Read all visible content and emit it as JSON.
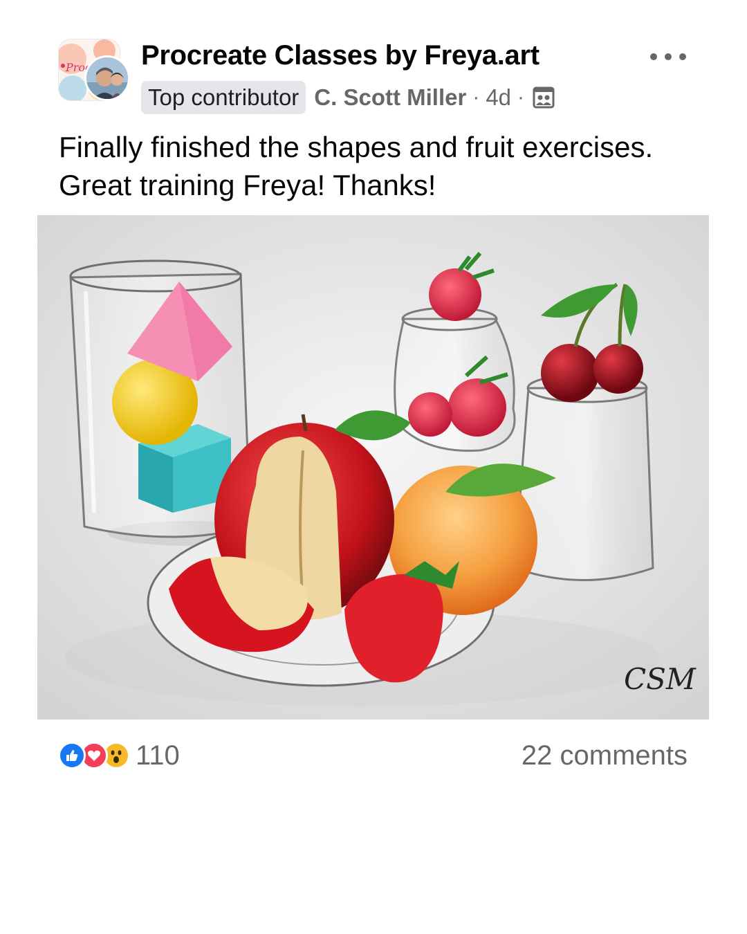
{
  "post": {
    "group_name": "Procreate Classes by Freya.art",
    "badge": "Top contributor",
    "author": "C. Scott Miller",
    "separator": "·",
    "time": "4d",
    "privacy_icon": "group-members-icon",
    "more_icon": "more-horizontal-icon",
    "text_lines": [
      "Finally finished the shapes and fruit exercises.",
      "Great training Freya! Thanks!"
    ],
    "image": {
      "subject": "still life drawing",
      "signature": "CSM"
    }
  },
  "engagement": {
    "reaction_icons": [
      "like-icon",
      "love-icon",
      "wow-icon"
    ],
    "reaction_count": "110",
    "comments_label": "22 comments"
  },
  "colors": {
    "like": "#1877f2",
    "love": "#f33e58",
    "wow": "#f7b928",
    "secondary_text": "#65676b",
    "badge_bg": "#e4e6eb"
  }
}
